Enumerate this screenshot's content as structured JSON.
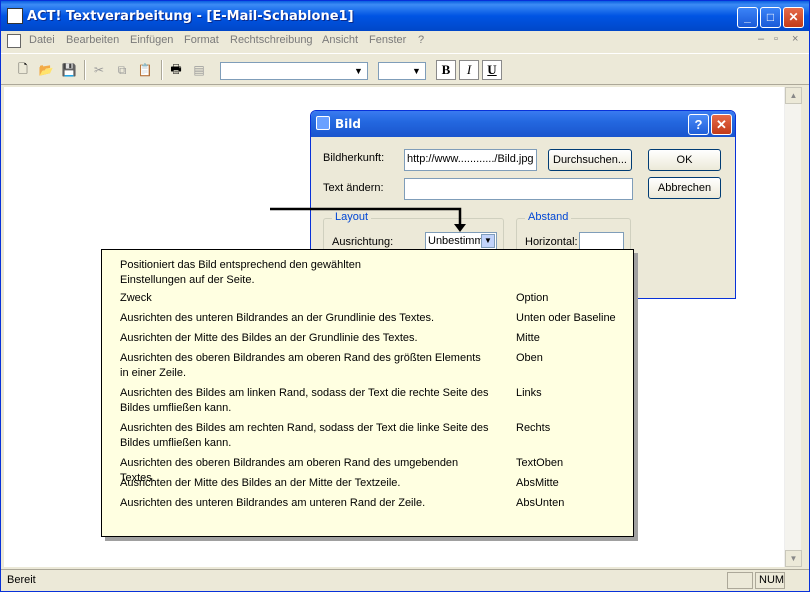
{
  "window": {
    "title": "ACT! Textverarbeitung - [E-Mail-Schablone1]"
  },
  "menu": [
    "Datei",
    "Bearbeiten",
    "Einfügen",
    "Format",
    "Rechtschreibung",
    "Ansicht",
    "Fenster",
    "?"
  ],
  "toolbar": {
    "bold": "B",
    "italic": "I",
    "underline": "U"
  },
  "status": {
    "text": "Bereit",
    "num": "NUM"
  },
  "dialog": {
    "title": "Bild",
    "help_glyph": "?",
    "source_label": "Bildherkunft:",
    "source_value": "http://www............/Bild.jpg",
    "browse": "Durchsuchen...",
    "ok": "OK",
    "alt_label": "Text ändern:",
    "alt_value": "",
    "cancel": "Abbrechen",
    "layout_group": "Layout",
    "align_label": "Ausrichtung:",
    "align_value": "Unbestimmt",
    "spacing_group": "Abstand",
    "horizontal_label": "Horizontal:"
  },
  "tooltip": {
    "intro": "Positioniert das Bild entsprechend den gewählten Einstellungen auf der Seite.",
    "header": {
      "purpose": "Zweck",
      "option": "Option"
    },
    "rows": [
      {
        "purpose": "Ausrichten des unteren Bildrandes an der Grundlinie des Textes.",
        "option": "Unten oder Baseline"
      },
      {
        "purpose": "Ausrichten der Mitte des Bildes an der Grundlinie des Textes.",
        "option": "Mitte"
      },
      {
        "purpose": "Ausrichten des oberen Bildrandes am oberen Rand des größten Elements in einer Zeile.",
        "option": "Oben"
      },
      {
        "purpose": "Ausrichten des Bildes am linken Rand, sodass der Text die rechte Seite des Bildes umfließen kann.",
        "option": "Links"
      },
      {
        "purpose": "Ausrichten des Bildes am rechten Rand, sodass der Text die linke Seite des Bildes umfließen kann.",
        "option": "Rechts"
      },
      {
        "purpose": "Ausrichten des oberen Bildrandes am oberen Rand des umgebenden Textes.",
        "option": "TextOben"
      },
      {
        "purpose": "Ausrichten der Mitte des Bildes an der Mitte der Textzeile.",
        "option": "AbsMitte"
      },
      {
        "purpose": "Ausrichten des unteren Bildrandes am unteren Rand der Zeile.",
        "option": "AbsUnten"
      }
    ]
  }
}
